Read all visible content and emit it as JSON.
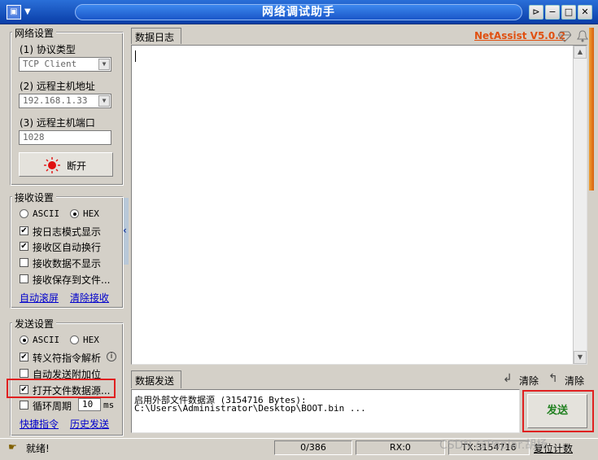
{
  "window": {
    "title": "网络调试助手",
    "controls": {
      "pin": "⊳",
      "minimize": "−",
      "maximize": "□",
      "close": "✕"
    }
  },
  "network_settings": {
    "title": "网络设置",
    "protocol_label": "(1) 协议类型",
    "protocol_value": "TCP Client",
    "remote_host_label": "(2) 远程主机地址",
    "remote_host_value": "192.168.1.33",
    "remote_port_label": "(3) 远程主机端口",
    "remote_port_value": "1028",
    "disconnect_label": "断开"
  },
  "receive_settings": {
    "title": "接收设置",
    "ascii_label": "ASCII",
    "hex_label": "HEX",
    "hex_selected": true,
    "options": [
      {
        "label": "按日志模式显示",
        "checked": true
      },
      {
        "label": "接收区自动换行",
        "checked": true
      },
      {
        "label": "接收数据不显示",
        "checked": false
      },
      {
        "label": "接收保存到文件...",
        "checked": false
      }
    ],
    "auto_scroll": "自动滚屏",
    "clear_receive": "清除接收"
  },
  "send_settings": {
    "title": "发送设置",
    "ascii_label": "ASCII",
    "hex_label": "HEX",
    "ascii_selected": true,
    "options": [
      {
        "label": "转义符指令解析",
        "checked": true
      },
      {
        "label": "自动发送附加位",
        "checked": false
      },
      {
        "label": "打开文件数据源...",
        "checked": true
      }
    ],
    "loop_label": "循环周期",
    "loop_value": "10",
    "loop_unit": "ms",
    "shortcut_cmd": "快捷指令",
    "history_send": "历史发送",
    "info_icon": "i"
  },
  "log": {
    "tab_label": "数据日志",
    "version": "NetAssist V5.0.2",
    "icons": {
      "diamond": "diamond-icon",
      "bell": "bell-icon"
    }
  },
  "send_area": {
    "tab_label": "数据发送",
    "clear_label_1": "清除",
    "clear_label_2": "清除",
    "line1": "启用外部文件数据源 (3154716 Bytes):",
    "line2": "C:\\Users\\Administrator\\Desktop\\BOOT.bin ...",
    "send_button": "发送"
  },
  "status_bar": {
    "ready": "就绪!",
    "counter": "0/386",
    "rx": "RX:0",
    "tx": "TX:3154716",
    "reset_count": "复位计数",
    "watermark": "CSDN @Poplar.胡杨"
  },
  "colors": {
    "highlight": "#e02020",
    "send_text": "#208020",
    "version": "#e05010"
  }
}
